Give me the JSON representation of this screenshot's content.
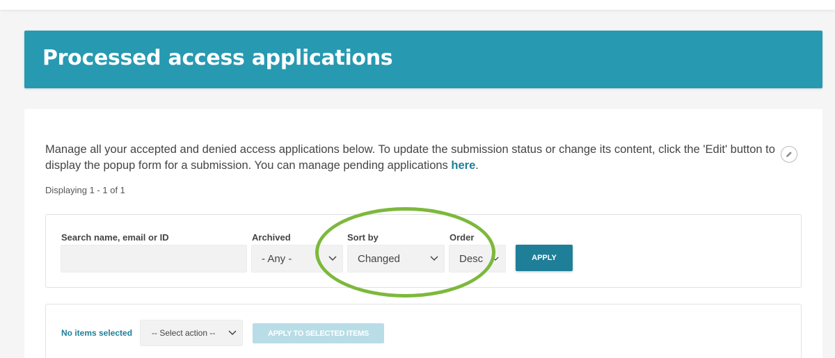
{
  "page": {
    "title": "Processed access applications",
    "intro_text": "Manage all your accepted and denied access applications below. To update the submission status or change its content, click the 'Edit' button to display the popup form for a submission. You can manage pending applications ",
    "intro_link": "here",
    "intro_end": ".",
    "count_text": "Displaying 1 - 1 of 1"
  },
  "filters": {
    "search_label": "Search name, email or ID",
    "search_value": "",
    "archived_label": "Archived",
    "archived_value": "- Any -",
    "sort_label": "Sort by",
    "sort_value": "Changed",
    "order_label": "Order",
    "order_value": "Desc",
    "apply_label": "APPLY"
  },
  "bulk": {
    "status": "No items selected",
    "select_action": "-- Select action --",
    "apply_selected": "APPLY TO SELECTED ITEMS"
  },
  "colors": {
    "header_bg": "#2799b1",
    "accent": "#1e7f96",
    "highlight_ring": "#7db83c"
  },
  "icons": {
    "edit": "pencil-icon",
    "dropdown": "chevron-down-icon"
  }
}
